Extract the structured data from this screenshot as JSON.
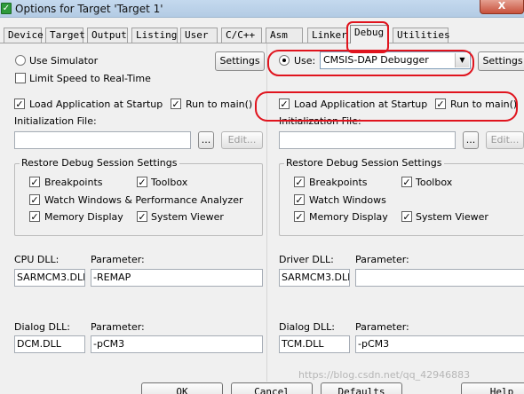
{
  "window": {
    "title": "Options for Target 'Target 1'",
    "close_label": "X"
  },
  "tabs": [
    {
      "label": "Device"
    },
    {
      "label": "Target"
    },
    {
      "label": "Output"
    },
    {
      "label": "Listing"
    },
    {
      "label": "User"
    },
    {
      "label": "C/C++"
    },
    {
      "label": "Asm"
    },
    {
      "label": "Linker"
    },
    {
      "label": "Debug",
      "active": true
    },
    {
      "label": "Utilities"
    }
  ],
  "left": {
    "use_simulator_label": "Use Simulator",
    "limit_speed_label": "Limit Speed to Real-Time",
    "settings_label": "Settings",
    "load_app_label": "Load Application at Startup",
    "run_to_main_label": "Run to main()",
    "init_file_label": "Initialization File:",
    "init_file_value": "",
    "browse_label": "...",
    "edit_label": "Edit...",
    "restore_group_label": "Restore Debug Session Settings",
    "restore_items": [
      "Breakpoints",
      "Toolbox",
      "Watch Windows & Performance Analyzer",
      "Memory Display",
      "System Viewer"
    ],
    "cpu_dll_label": "CPU DLL:",
    "cpu_dll_value": "SARMCM3.DLL",
    "cpu_param_label": "Parameter:",
    "cpu_param_value": "-REMAP",
    "dialog_dll_label": "Dialog DLL:",
    "dialog_dll_value": "DCM.DLL",
    "dialog_param_label": "Parameter:",
    "dialog_param_value": "-pCM3"
  },
  "right": {
    "use_label": "Use:",
    "debugger_value": "CMSIS-DAP Debugger",
    "settings_label": "Settings",
    "load_app_label": "Load Application at Startup",
    "run_to_main_label": "Run to main()",
    "init_file_label": "Initialization File:",
    "init_file_value": "",
    "browse_label": "...",
    "edit_label": "Edit...",
    "restore_group_label": "Restore Debug Session Settings",
    "restore_items": [
      "Breakpoints",
      "Toolbox",
      "Watch Windows",
      "Memory Display",
      "System Viewer"
    ],
    "driver_dll_label": "Driver DLL:",
    "driver_dll_value": "SARMCM3.DLL",
    "driver_param_label": "Parameter:",
    "driver_param_value": "",
    "dialog_dll_label": "Dialog DLL:",
    "dialog_dll_value": "TCM.DLL",
    "dialog_param_label": "Parameter:",
    "dialog_param_value": "-pCM3"
  },
  "footer": {
    "ok_label": "OK",
    "cancel_label": "Cancel",
    "defaults_label": "Defaults",
    "help_label": "Help"
  },
  "watermark": "https://blog.csdn.net/qq_42946883",
  "colors": {
    "annotation_red": "#e0141e",
    "dialog_bg": "#f0f0f0"
  }
}
